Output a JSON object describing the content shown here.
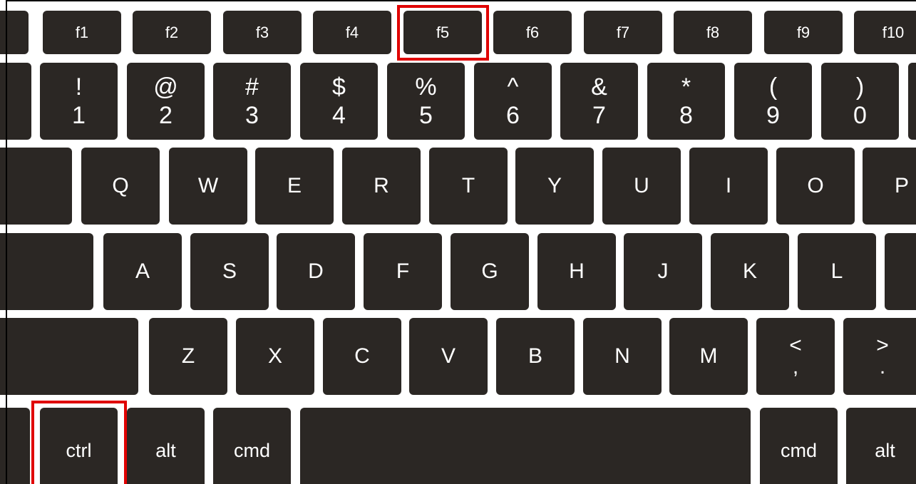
{
  "keyboard": {
    "function_row": [
      "",
      "f1",
      "f2",
      "f3",
      "f4",
      "f5",
      "f6",
      "f7",
      "f8",
      "f9",
      "f10"
    ],
    "number_row": [
      {
        "top": "",
        "bottom": ""
      },
      {
        "top": "!",
        "bottom": "1"
      },
      {
        "top": "@",
        "bottom": "2"
      },
      {
        "top": "#",
        "bottom": "3"
      },
      {
        "top": "$",
        "bottom": "4"
      },
      {
        "top": "%",
        "bottom": "5"
      },
      {
        "top": "^",
        "bottom": "6"
      },
      {
        "top": "&",
        "bottom": "7"
      },
      {
        "top": "*",
        "bottom": "8"
      },
      {
        "top": "(",
        "bottom": "9"
      },
      {
        "top": ")",
        "bottom": "0"
      },
      {
        "top": "",
        "bottom": ""
      }
    ],
    "qwerty_row": [
      "",
      "Q",
      "W",
      "E",
      "R",
      "T",
      "Y",
      "U",
      "I",
      "O",
      "P"
    ],
    "home_row": [
      "",
      "A",
      "S",
      "D",
      "F",
      "G",
      "H",
      "J",
      "K",
      "L"
    ],
    "bottom_letter_row": [
      "",
      "Z",
      "X",
      "C",
      "V",
      "B",
      "N",
      "M"
    ],
    "punct_keys": [
      {
        "top": "<",
        "bottom": ","
      },
      {
        "top": ">",
        "bottom": "."
      }
    ],
    "modifier_row": [
      "",
      "ctrl",
      "alt",
      "cmd",
      "",
      "cmd",
      "alt"
    ]
  },
  "highlights": {
    "color": "#e00000",
    "keys": [
      "f5",
      "ctrl"
    ]
  },
  "colors": {
    "key_fill": "#2b2724",
    "key_text": "#ffffff",
    "background": "#ffffff"
  }
}
